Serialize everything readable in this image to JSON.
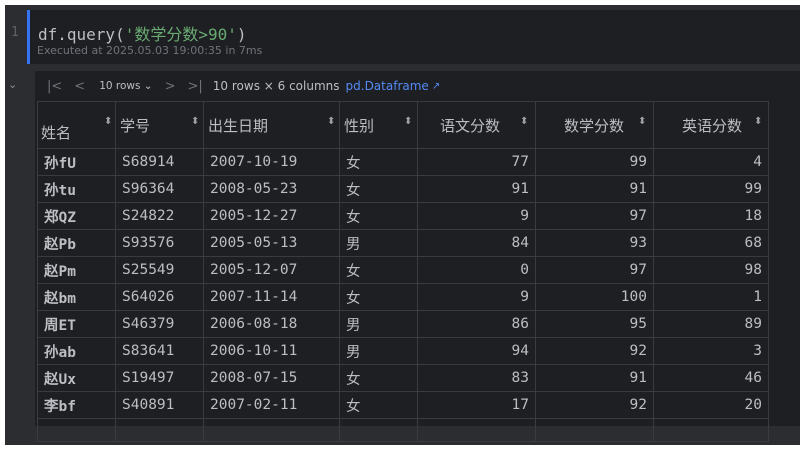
{
  "cell": {
    "line_number": "1",
    "code_prefix": "df.query(",
    "code_string": "'数学分数>90'",
    "code_suffix": ")",
    "execution_info": "Executed at 2025.05.03 19:00:35 in 7ms"
  },
  "toolbar": {
    "first_icon": "|<",
    "prev_icon": "<",
    "rows_per_page": "10 rows ⌄",
    "next_icon": ">",
    "last_icon": ">|",
    "info": "10 rows × 6 columns",
    "link": "pd.Dataframe",
    "link_arrow": "↗"
  },
  "table": {
    "columns": [
      "姓名",
      "学号",
      "出生日期",
      "性别",
      "语文分数",
      "数学分数",
      "英语分数"
    ],
    "sort_icon": "⬍",
    "rows": [
      [
        "孙fU",
        "S68914",
        "2007-10-19",
        "女",
        "77",
        "99",
        "4"
      ],
      [
        "孙tu",
        "S96364",
        "2008-05-23",
        "女",
        "91",
        "91",
        "99"
      ],
      [
        "郑QZ",
        "S24822",
        "2005-12-27",
        "女",
        "9",
        "97",
        "18"
      ],
      [
        "赵Pb",
        "S93576",
        "2005-05-13",
        "男",
        "84",
        "93",
        "68"
      ],
      [
        "赵Pm",
        "S25549",
        "2005-12-07",
        "女",
        "0",
        "97",
        "98"
      ],
      [
        "赵bm",
        "S64026",
        "2007-11-14",
        "女",
        "9",
        "100",
        "1"
      ],
      [
        "周ET",
        "S46379",
        "2006-08-18",
        "男",
        "86",
        "95",
        "89"
      ],
      [
        "孙ab",
        "S83641",
        "2006-10-11",
        "男",
        "94",
        "92",
        "3"
      ],
      [
        "赵Ux",
        "S19497",
        "2008-07-15",
        "女",
        "83",
        "91",
        "46"
      ],
      [
        "李bf",
        "S40891",
        "2007-02-11",
        "女",
        "17",
        "92",
        "20"
      ]
    ]
  }
}
